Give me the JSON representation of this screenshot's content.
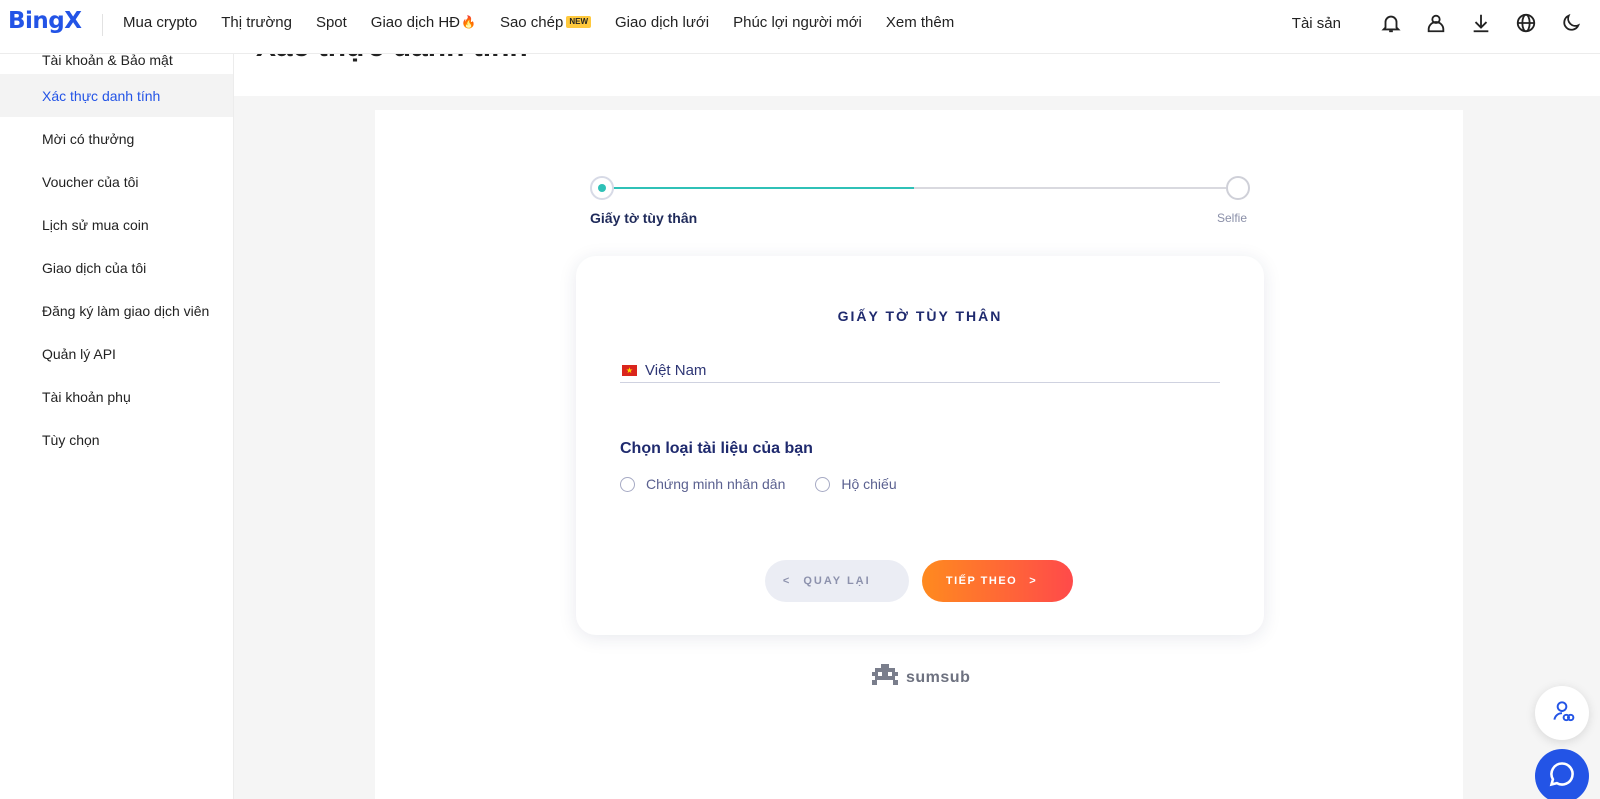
{
  "header": {
    "logo": "BingX",
    "nav": [
      {
        "label": "Mua crypto"
      },
      {
        "label": "Thị trường"
      },
      {
        "label": "Spot"
      },
      {
        "label": "Giao dịch HĐ"
      },
      {
        "label": "Sao chép",
        "badge": "NEW"
      },
      {
        "label": "Giao dịch lưới"
      },
      {
        "label": "Phúc lợi người mới"
      },
      {
        "label": "Xem thêm"
      }
    ],
    "assets_label": "Tài sản",
    "icons": [
      "bell-icon",
      "user-icon",
      "download-icon",
      "globe-icon",
      "moon-icon"
    ]
  },
  "sidebar": {
    "items": [
      {
        "label": "Tài khoản & Bảo mật",
        "active": false
      },
      {
        "label": "Xác thực danh tính",
        "active": true
      },
      {
        "label": "Mời có thưởng",
        "active": false
      },
      {
        "label": "Voucher của tôi",
        "active": false
      },
      {
        "label": "Lịch sử mua coin",
        "active": false
      },
      {
        "label": "Giao dịch của tôi",
        "active": false
      },
      {
        "label": "Đăng ký làm giao dịch viên",
        "active": false
      },
      {
        "label": "Quản lý API",
        "active": false
      },
      {
        "label": "Tài khoản phụ",
        "active": false
      },
      {
        "label": "Tùy chọn",
        "active": false
      }
    ]
  },
  "page": {
    "heading": "Xác thực danh tính"
  },
  "stepper": {
    "steps": [
      "Giấy tờ tùy thân",
      "Selfie"
    ],
    "progress": 0.5,
    "progress_color": "#2fc1b7"
  },
  "card": {
    "title": "GIẤY TỜ TÙY THÂN",
    "country": "Việt Nam",
    "doc_title": "Chọn loại tài liệu của bạn",
    "options": [
      {
        "label": "Chứng minh nhân dân",
        "selected": false
      },
      {
        "label": "Hộ chiếu",
        "selected": false
      }
    ],
    "back_label": "QUAY LẠI",
    "next_label": "TIẾP THEO"
  },
  "footer": {
    "brand": "sumsub"
  },
  "colors": {
    "brand": "#2354e6",
    "accent_gradient_start": "#ff8a1f",
    "accent_gradient_end": "#ff4a4a",
    "navy": "#1f2a6e"
  }
}
